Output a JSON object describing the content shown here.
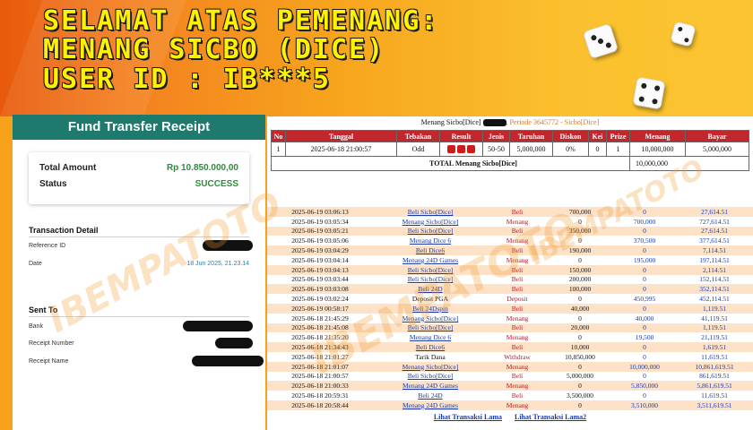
{
  "banner": {
    "line1": "SELAMAT ATAS PEMENANG:",
    "line2": "MENANG SICBO (DICE)",
    "line3": "USER ID : IB***5"
  },
  "receipt": {
    "title": "Fund Transfer Receipt",
    "total_label": "Total Amount",
    "total_value": "Rp 10.850.000,00",
    "status_label": "Status",
    "status_value": "SUCCESS",
    "detail_title": "Transaction Detail",
    "ref_label": "Reference ID",
    "date_label": "Date",
    "date_value": "18 Jun 2025, 21.23.14",
    "sent_title": "Sent To",
    "bank_label": "Bank",
    "recnum_label": "Receipt Number",
    "recname_label": "Receipt Name"
  },
  "results": {
    "title_prefix": "Menang Sicbo[Dice]",
    "title_period": ", Periode 3645772 - Sicbo[Dice]",
    "headers": [
      "No",
      "Tanggal",
      "Tebakan",
      "Result",
      "Jenis",
      "Taruhan",
      "Diskon",
      "Kei",
      "Prize",
      "Menang",
      "Bayar"
    ],
    "row": {
      "no": "1",
      "tanggal": "2025-06-18 21:00:57",
      "tebakan": "Odd",
      "jenis": "50-50",
      "taruhan": "5,000,000",
      "diskon": "0%",
      "kei": "0",
      "prize": "1",
      "menang": "10,000,000",
      "bayar": "5,000,000"
    },
    "total_label": "TOTAL  Menang Sicbo[Dice]",
    "total_value": "10,000,000",
    "transactions": [
      {
        "date": "2025-06-19 03:06:13",
        "act": "Beli Sicbo[Dice]",
        "type": "Beli",
        "a": "700,000",
        "b": "0",
        "c": "27,614.51"
      },
      {
        "date": "2025-06-19 03:05:34",
        "act": "Menang Sicbo[Dice]",
        "type": "Menang",
        "a": "0",
        "b": "700,000",
        "c": "727,614.51"
      },
      {
        "date": "2025-06-19 03:05:21",
        "act": "Beli Sicbo[Dice]",
        "type": "Beli",
        "a": "350,000",
        "b": "0",
        "c": "27,614.51"
      },
      {
        "date": "2025-06-19 03:05:06",
        "act": "Menang Dice 6",
        "type": "Menang",
        "a": "0",
        "b": "370,500",
        "c": "377,614.51"
      },
      {
        "date": "2025-06-19 03:04:29",
        "act": "Beli Dice6",
        "type": "Beli",
        "a": "190,000",
        "b": "0",
        "c": "7,114.51"
      },
      {
        "date": "2025-06-19 03:04:14",
        "act": "Menang 24D Games",
        "type": "Menang",
        "a": "0",
        "b": "195,000",
        "c": "197,114.51"
      },
      {
        "date": "2025-06-19 03:04:13",
        "act": "Beli Sicbo[Dice]",
        "type": "Beli",
        "a": "150,000",
        "b": "0",
        "c": "2,114.51"
      },
      {
        "date": "2025-06-19 03:03:44",
        "act": "Beli Sicbo[Dice]",
        "type": "Beli",
        "a": "200,000",
        "b": "0",
        "c": "152,114.51"
      },
      {
        "date": "2025-06-19 03:03:08",
        "act": "Beli 24D",
        "type": "Beli",
        "a": "100,000",
        "b": "0",
        "c": "352,114.51"
      },
      {
        "date": "2025-06-19 03:02:24",
        "act": "Deposit PGA",
        "type": "Deposit",
        "a": "0",
        "b": "450,995",
        "c": "452,114.51",
        "plain": true
      },
      {
        "date": "2025-06-19 00:58:17",
        "act": "Beli 24Dspin",
        "type": "Beli",
        "a": "40,000",
        "b": "0",
        "c": "1,119.51"
      },
      {
        "date": "2025-06-18 21:45:29",
        "act": "Menang Sicbo[Dice]",
        "type": "Menang",
        "a": "0",
        "b": "40,000",
        "c": "41,119.51"
      },
      {
        "date": "2025-06-18 21:45:08",
        "act": "Beli Sicbo[Dice]",
        "type": "Beli",
        "a": "20,000",
        "b": "0",
        "c": "1,119.51"
      },
      {
        "date": "2025-06-18 21:35:20",
        "act": "Menang Dice 6",
        "type": "Menang",
        "a": "0",
        "b": "19,500",
        "c": "21,119.51"
      },
      {
        "date": "2025-06-18 21:34:43",
        "act": "Beli Dice6",
        "type": "Beli",
        "a": "10,000",
        "b": "0",
        "c": "1,619.51"
      },
      {
        "date": "2025-06-18 21:01:27",
        "act": "Tarik Dana",
        "type": "Withdraw",
        "a": "10,850,000",
        "b": "0",
        "c": "11,619.51",
        "plain": true
      },
      {
        "date": "2025-06-18 21:01:07",
        "act": "Menang Sicbo[Dice]",
        "type": "Menang",
        "a": "0",
        "b": "10,000,000",
        "c": "10,861,619.51"
      },
      {
        "date": "2025-06-18 21:00:57",
        "act": "Beli Sicbo[Dice]",
        "type": "Beli",
        "a": "5,000,000",
        "b": "0",
        "c": "861,619.51"
      },
      {
        "date": "2025-06-18 21:00:33",
        "act": "Menang 24D Games",
        "type": "Menang",
        "a": "0",
        "b": "5,850,000",
        "c": "5,861,619.51"
      },
      {
        "date": "2025-06-18 20:59:31",
        "act": "Beli 24D",
        "type": "Beli",
        "a": "3,500,000",
        "b": "0",
        "c": "11,619.51"
      },
      {
        "date": "2025-06-18 20:58:44",
        "act": "Menang 24D Games",
        "type": "Menang",
        "a": "0",
        "b": "3,510,000",
        "c": "3,511,619.51"
      }
    ],
    "link1": "Lihat Transaksi Lama",
    "link2": "Lihat Transaksi Lama2"
  },
  "watermark": "IBEMPATOTO"
}
